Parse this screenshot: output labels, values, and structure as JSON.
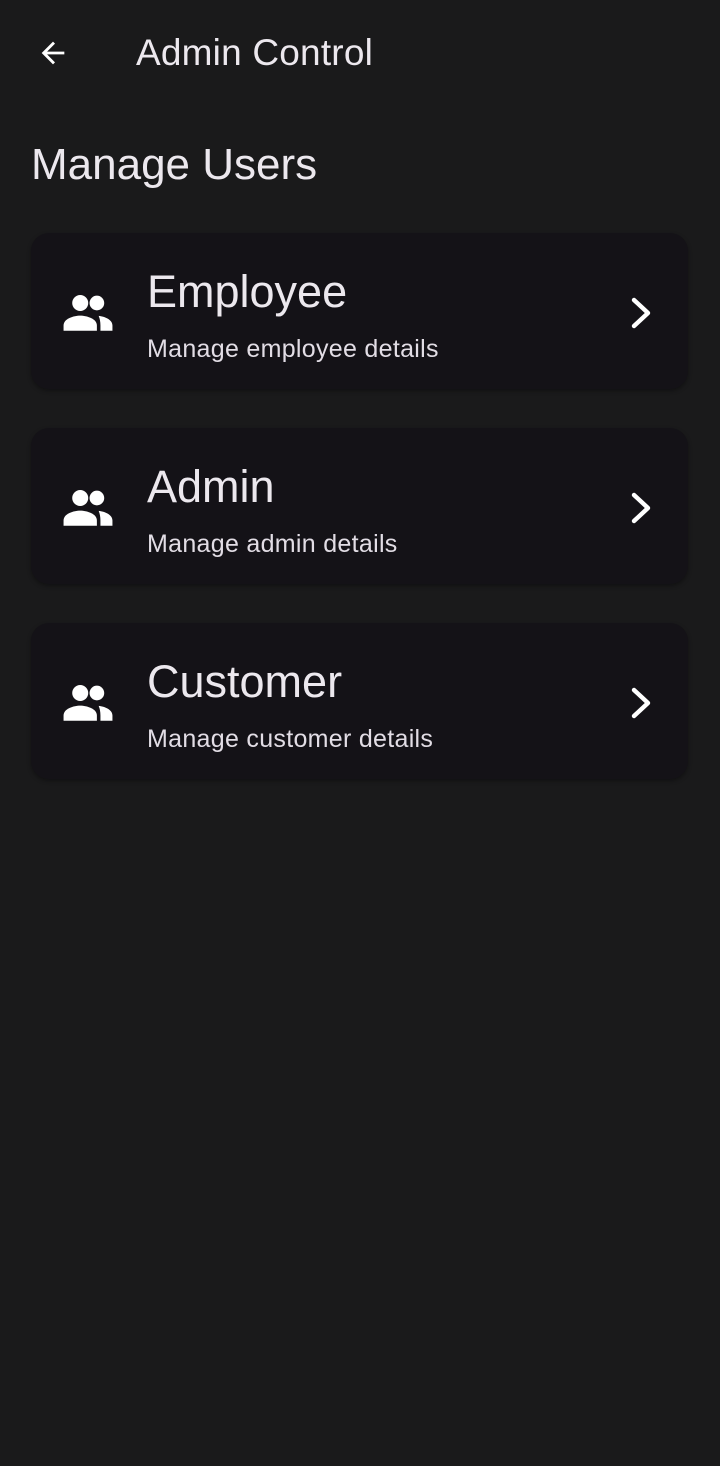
{
  "header": {
    "title": "Admin Control",
    "back_icon": "arrow-back-icon"
  },
  "main": {
    "section_title": "Manage Users",
    "items": [
      {
        "title": "Employee",
        "subtitle": "Manage employee details",
        "icon": "people-icon"
      },
      {
        "title": "Admin",
        "subtitle": "Manage admin details",
        "icon": "people-icon"
      },
      {
        "title": "Customer",
        "subtitle": "Manage customer details",
        "icon": "people-icon"
      }
    ]
  },
  "colors": {
    "background": "#1a1a1b",
    "card": "#141217",
    "text": "#ece8ee"
  }
}
